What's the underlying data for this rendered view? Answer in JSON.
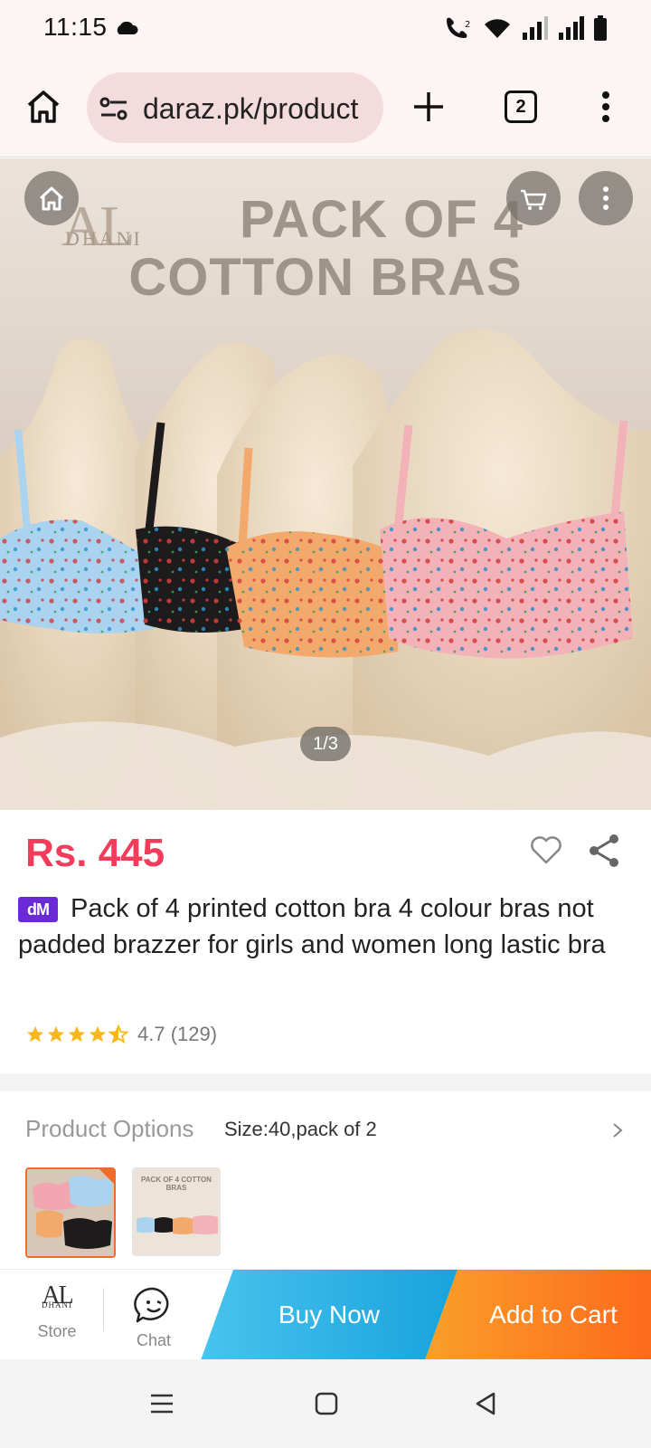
{
  "status_bar": {
    "time": "11:15"
  },
  "browser": {
    "url": "daraz.pk/product",
    "tab_count": "2"
  },
  "hero": {
    "brand_logo": "AL",
    "brand_sub": "DHANI",
    "title_line1": "PACK OF 4",
    "title_line2": "COTTON BRAS",
    "pager": "1/3"
  },
  "product": {
    "price": "Rs. 445",
    "badge": "dM",
    "title": "Pack of 4 printed cotton bra 4 colour bras not padded brazzer for girls and women long lastic bra",
    "rating_value": 4.7,
    "rating_text": "4.7 (129)"
  },
  "options": {
    "label": "Product Options",
    "value": "Size:40,pack of 2",
    "thumb2_title": "PACK OF 4 COTTON BRAS"
  },
  "actions": {
    "store_logo": "AL",
    "store_logo_sub": "DHANI",
    "store_label": "Store",
    "chat_label": "Chat",
    "buy_now": "Buy Now",
    "add_to_cart": "Add to Cart"
  },
  "colors": {
    "price": "#f23d5a",
    "buy_now": "#17a3dc",
    "add_to_cart": "#fd6a1d",
    "badge": "#6a2bd6"
  }
}
